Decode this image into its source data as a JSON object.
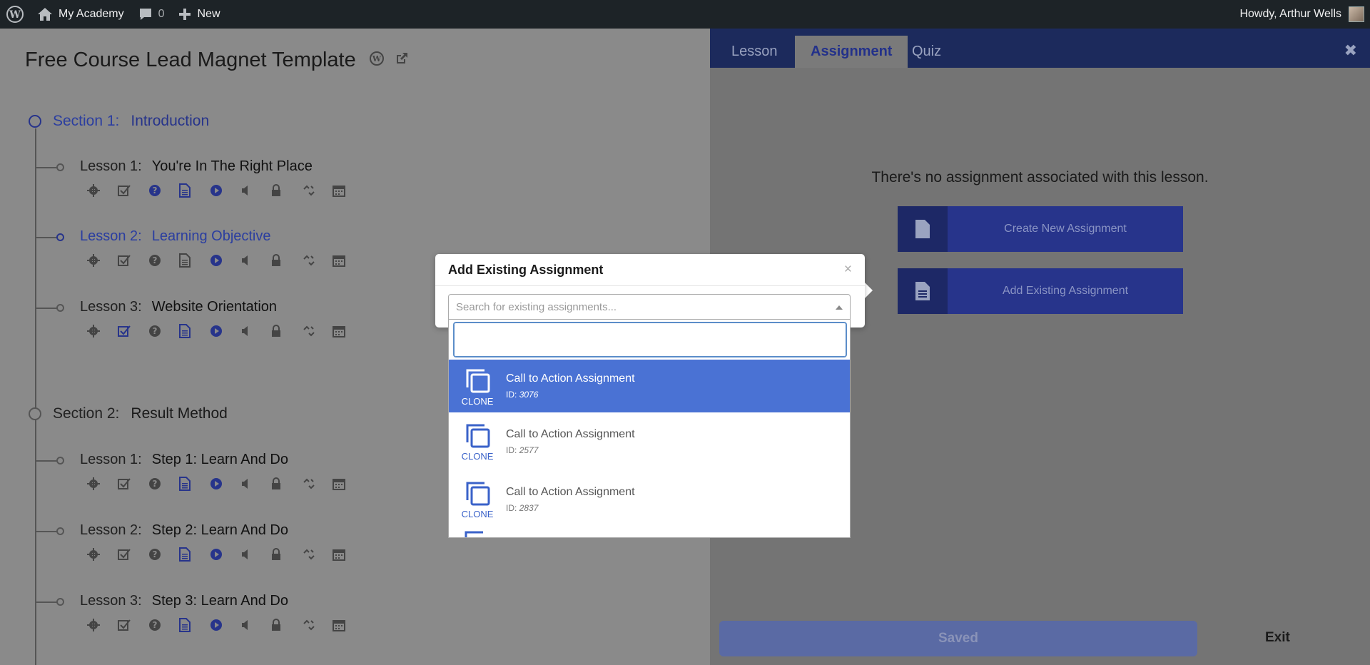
{
  "adminbar": {
    "site_name": "My Academy",
    "comments_count": "0",
    "new_label": "New",
    "greeting": "Howdy, Arthur Wells"
  },
  "course": {
    "title": "Free Course Lead Magnet Template",
    "sections": [
      {
        "prefix": "Section 1:",
        "name": "Introduction",
        "lessons": [
          {
            "prefix": "Lesson 1:",
            "name": "You're In The Right Place"
          },
          {
            "prefix": "Lesson 2:",
            "name": "Learning Objective"
          },
          {
            "prefix": "Lesson 3:",
            "name": "Website Orientation"
          }
        ]
      },
      {
        "prefix": "Section 2:",
        "name": "Result Method",
        "lessons": [
          {
            "prefix": "Lesson 1:",
            "name": "Step 1: Learn And Do"
          },
          {
            "prefix": "Lesson 2:",
            "name": "Step 2: Learn And Do"
          },
          {
            "prefix": "Lesson 3:",
            "name": "Step 3: Learn And Do"
          }
        ]
      }
    ]
  },
  "panel": {
    "tabs": [
      "Lesson",
      "Assignment",
      "Quiz"
    ],
    "active_tab": "Assignment",
    "empty_message": "There's no assignment associated with this lesson.",
    "create_label": "Create New Assignment",
    "add_label": "Add Existing Assignment",
    "saved_label": "Saved",
    "exit_label": "Exit"
  },
  "modal": {
    "title": "Add Existing Assignment",
    "close": "×",
    "placeholder": "Search for existing assignments...",
    "search_value": "",
    "results": [
      {
        "clone_label": "CLONE",
        "name": "Call to Action Assignment",
        "id_prefix": "ID:",
        "id": "3076",
        "selected": true
      },
      {
        "clone_label": "CLONE",
        "name": "Call to Action Assignment",
        "id_prefix": "ID:",
        "id": "2577",
        "selected": false
      },
      {
        "clone_label": "CLONE",
        "name": "Call to Action Assignment",
        "id_prefix": "ID:",
        "id": "2837",
        "selected": false
      }
    ]
  },
  "colors": {
    "primary": "#27348b",
    "tabbar": "#1c2a5c",
    "highlight": "#4a72d4",
    "adminbar": "#1d2327"
  }
}
